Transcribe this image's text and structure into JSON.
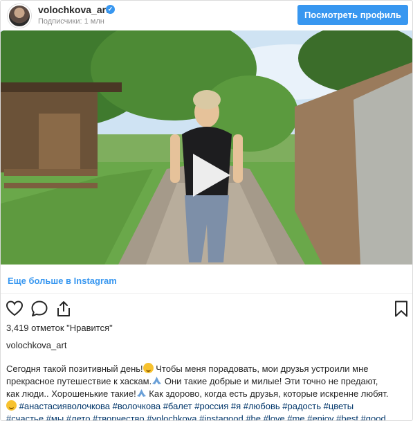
{
  "post": {
    "username": "volochkova_art",
    "followers": "Подписчики: 1 млн",
    "view_profile": "Посмотреть профиль",
    "more_on_instagram": "Еще больше в Instagram",
    "likes": "3,419 отметок \"Нравится\"",
    "author": "volochkova_art"
  },
  "caption": {
    "line1_a": "Сегодня такой позитивный день!",
    "line1_b": " Чтобы меня порадовать, мои друзья устроили мне",
    "line2_a": "прекрасное путешествие к хаскам.",
    "line2_b": " Они такие добрые и милые! Эти точно не предают,",
    "line3_a": "как люди.. Хорошенькие такие!",
    "line3_b": " Как здорово, когда есть друзья, которые искренне любят.",
    "line4": " #анастасияволочкова #волочкова #балет #россия #я #любовь #радость #цветы",
    "line5": "#счастье #мы #лето #творчество #volochkova #instagood #be #love #me #enjoy #best #good"
  },
  "colors": {
    "accent": "#3897f0",
    "hashtag": "#003569",
    "muted": "#8e8e8e"
  },
  "icons": [
    "verified-badge-icon",
    "play-icon",
    "heart-icon",
    "comment-icon",
    "share-icon",
    "bookmark-icon",
    "smile-emoji-icon",
    "praying-hands-icon"
  ]
}
